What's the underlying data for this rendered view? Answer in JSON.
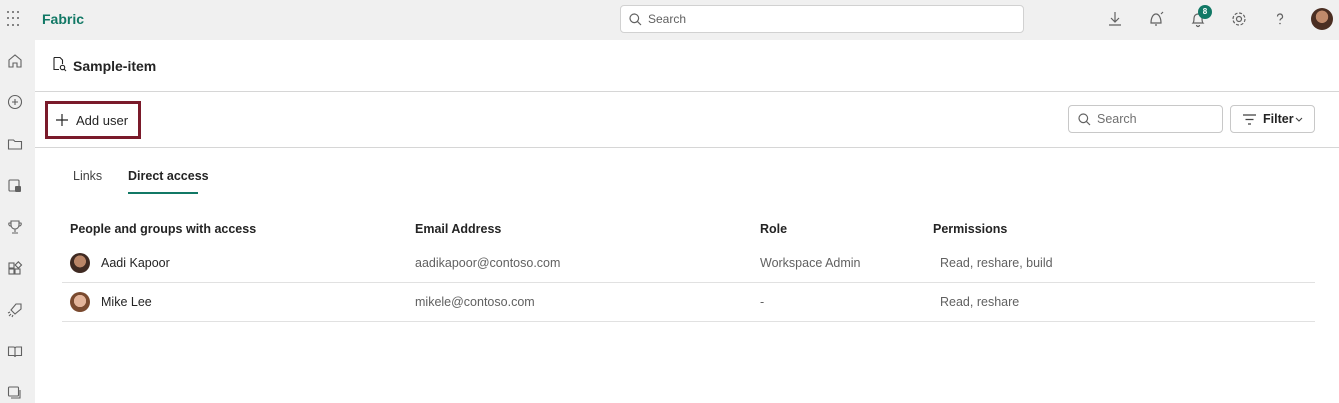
{
  "topbar": {
    "brand": "Fabric",
    "search_placeholder": "Search",
    "notification_count": "8"
  },
  "page": {
    "title": "Sample-item"
  },
  "toolbar": {
    "add_user_label": "Add user",
    "search_placeholder": "Search",
    "filter_label": "Filter"
  },
  "tabs": [
    {
      "label": "Links",
      "active": false
    },
    {
      "label": "Direct access",
      "active": true
    }
  ],
  "table": {
    "headers": [
      "People and groups with access",
      "Email Address",
      "Role",
      "Permissions"
    ],
    "rows": [
      {
        "name": "Aadi Kapoor",
        "email": "aadikapoor@contoso.com",
        "role": "Workspace Admin",
        "permissions": "Read, reshare, build"
      },
      {
        "name": "Mike Lee",
        "email": "mikele@contoso.com",
        "role": "-",
        "permissions": "Read, reshare"
      }
    ]
  },
  "colors": {
    "accent": "#117865",
    "highlight_border": "#7a1a2a"
  }
}
